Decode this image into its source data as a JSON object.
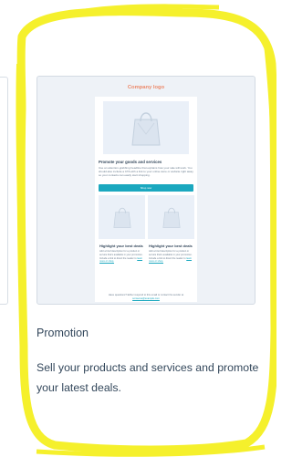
{
  "template": {
    "preview": {
      "logo": "Company logo",
      "hero_heading": "Promote your goods and services",
      "hero_body": "Use an attention-grabbing headline that explains how your sale will work. You should also include a CTA with a link to your online store or website right away so your contacts can easily start shopping.",
      "button_label": "Shop now",
      "columns": [
        {
          "heading": "Highlight your best deals",
          "body": "Add a brief description for a product or service that's available in your promotion. Include a link to direct the reader to",
          "link": "learn more or shop."
        },
        {
          "heading": "Highlight your best deals",
          "body": "Add a brief description for a product or service that's available in your promotion. Include a link to direct the reader to",
          "link": "learn more or shop."
        }
      ],
      "footer_text": "Have questions? Either respond to this email or contact the sender at",
      "footer_link": "someone@example.com"
    },
    "title": "Promotion",
    "description": "Sell your products and services and promote your latest deals."
  },
  "colors": {
    "highlight": "#f5f02c",
    "accent": "#1ba8bf",
    "logo": "#ec8a6b",
    "text": "#33475b"
  }
}
